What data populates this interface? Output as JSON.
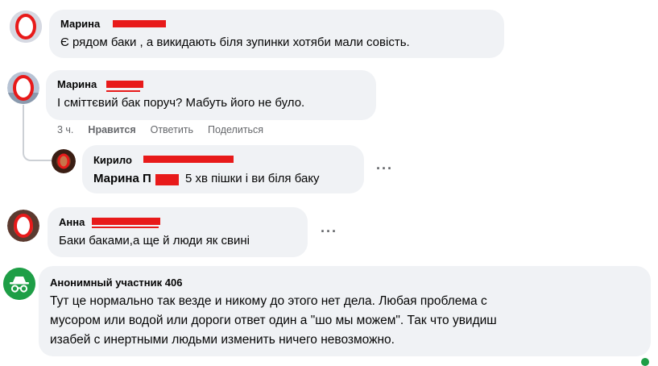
{
  "comments": [
    {
      "author": "Марина",
      "text": "Є рядом баки , а викидають біля зупинки хотяби мали совість."
    },
    {
      "author": "Марина",
      "text": "І сміттєвий бак поруч? Мабуть його не було.",
      "meta": {
        "time": "3 ч.",
        "like_label": "Нравится",
        "reply_label": "Ответить",
        "share_label": "Поделиться"
      }
    },
    {
      "author": "Кирило",
      "mention": "Марина П",
      "text": "5 хв пішки і ви біля баку",
      "more_label": "···"
    },
    {
      "author": "Анна",
      "text": "Баки баками,а ще й люди як свині",
      "more_label": "···"
    },
    {
      "author": "Анонимный участник 406",
      "text_lines": [
        "Тут це нормально так везде и никому до этого нет дела. Любая проблема с",
        "мусором или водой или дороги ответ один а \"шо мы можем\". Так что увидиш",
        "изабей с инертными людьми изменить ничего невозможно."
      ]
    }
  ],
  "colors": {
    "bubble": "#f0f2f5",
    "redaction": "#e81a1a",
    "secondary_text": "#65676b",
    "anon_avatar": "#1e9e46"
  },
  "icons": {
    "anonymous_avatar": "incognito-icon"
  }
}
